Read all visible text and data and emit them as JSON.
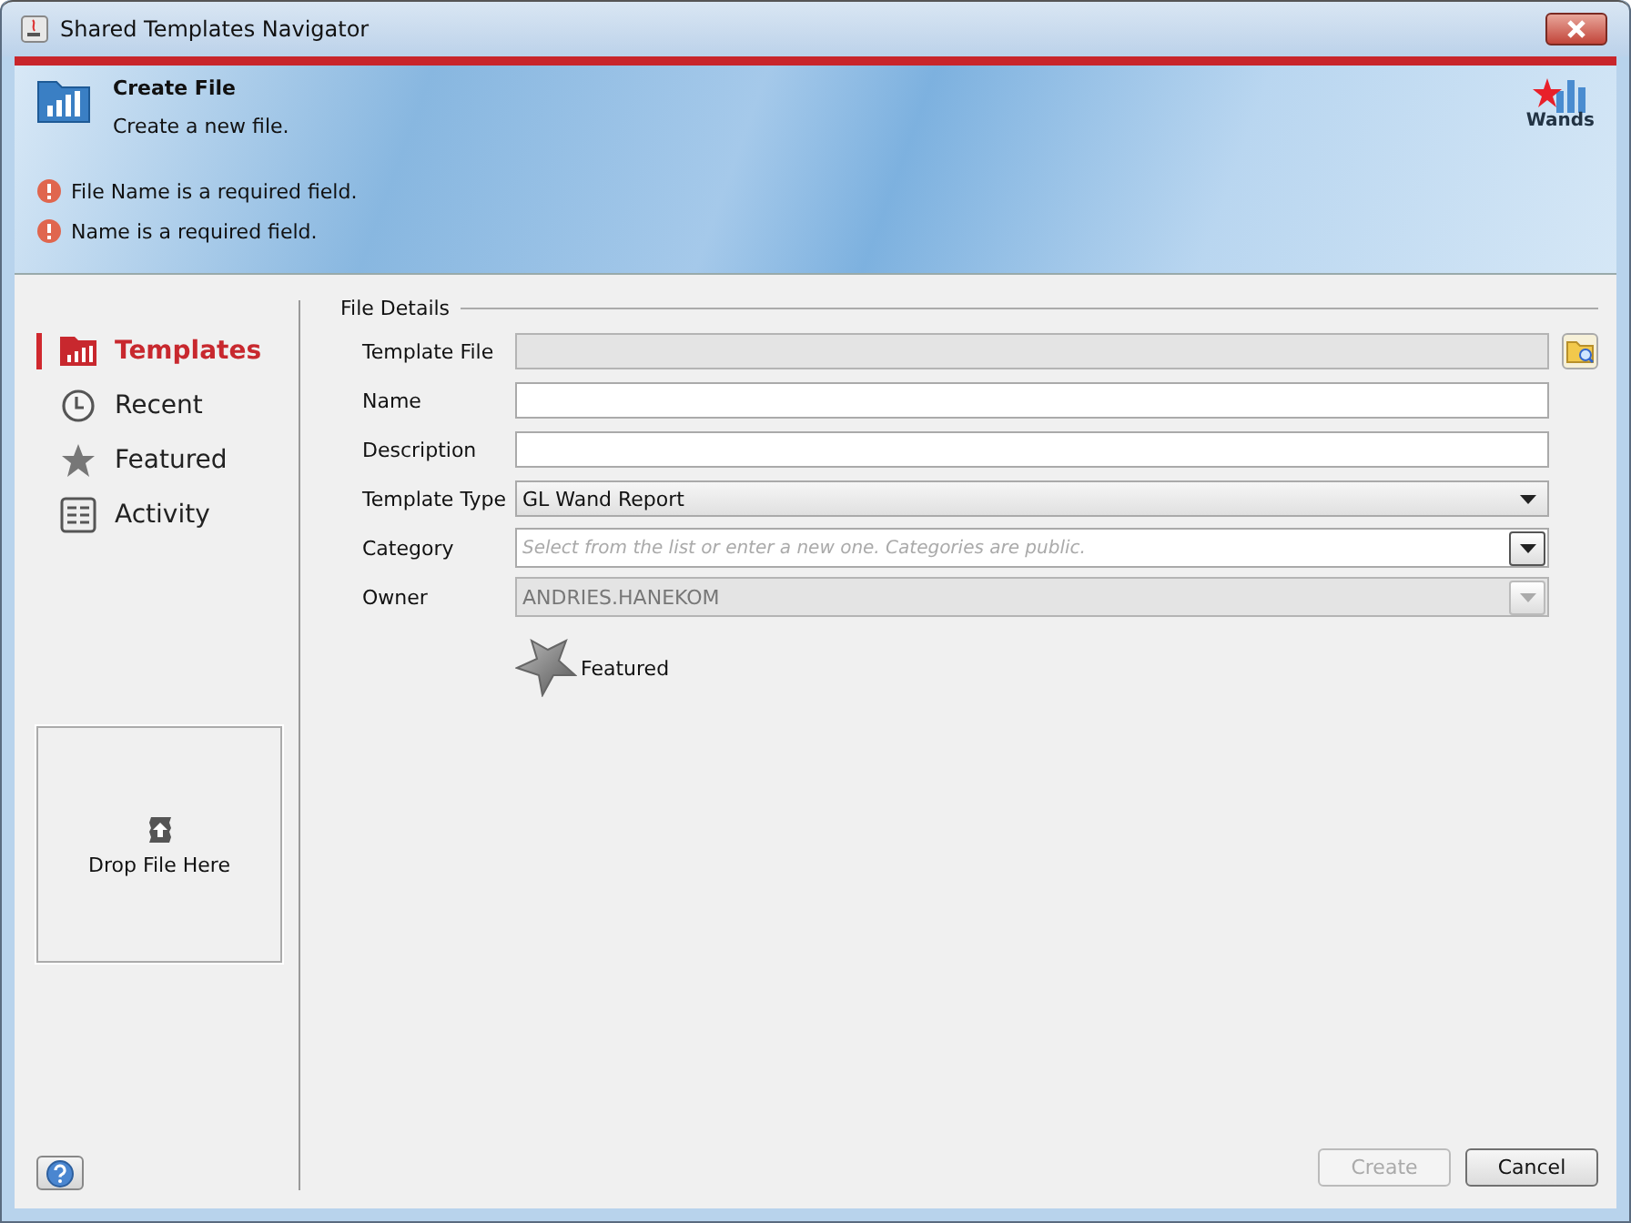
{
  "window": {
    "title": "Shared Templates Navigator"
  },
  "header": {
    "title": "Create File",
    "subtitle": "Create a new file.",
    "logo_text": "Wands",
    "errors": [
      "File Name is a required field.",
      "Name is a required field."
    ]
  },
  "sidebar": {
    "items": [
      {
        "label": "Templates",
        "kind": "chart",
        "selected": true
      },
      {
        "label": "Recent",
        "kind": "clock",
        "selected": false
      },
      {
        "label": "Featured",
        "kind": "star",
        "selected": false
      },
      {
        "label": "Activity",
        "kind": "list",
        "selected": false
      }
    ],
    "drop_zone": "Drop File Here"
  },
  "form": {
    "legend": "File Details",
    "fields": [
      {
        "label": "Template File",
        "kind": "text",
        "disabled": true,
        "browse": true
      },
      {
        "label": "Name",
        "kind": "text",
        "disabled": false
      },
      {
        "label": "Description",
        "kind": "text",
        "disabled": false
      },
      {
        "label": "Template Type",
        "kind": "select",
        "value": "GL Wand Report"
      },
      {
        "label": "Category",
        "kind": "combo",
        "disabled": false,
        "placeholder": "Select from the list or enter a new one. Categories are public."
      },
      {
        "label": "Owner",
        "kind": "combo",
        "disabled": true,
        "value": "ANDRIES.HANEKOM"
      }
    ],
    "featured": {
      "label": "Featured",
      "checked": false
    }
  },
  "buttons": [
    {
      "label": "Create",
      "disabled": true
    },
    {
      "label": "Cancel",
      "disabled": false
    }
  ]
}
